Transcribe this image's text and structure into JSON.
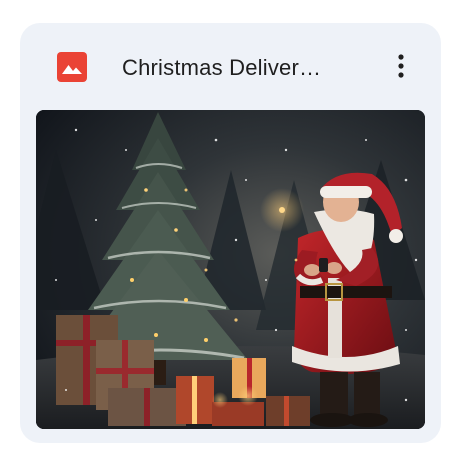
{
  "file_card": {
    "title": "Christmas Deliver…",
    "file_type_icon": "image-icon",
    "file_type_color": "#ea4335",
    "more_icon": "more-vertical-icon"
  }
}
